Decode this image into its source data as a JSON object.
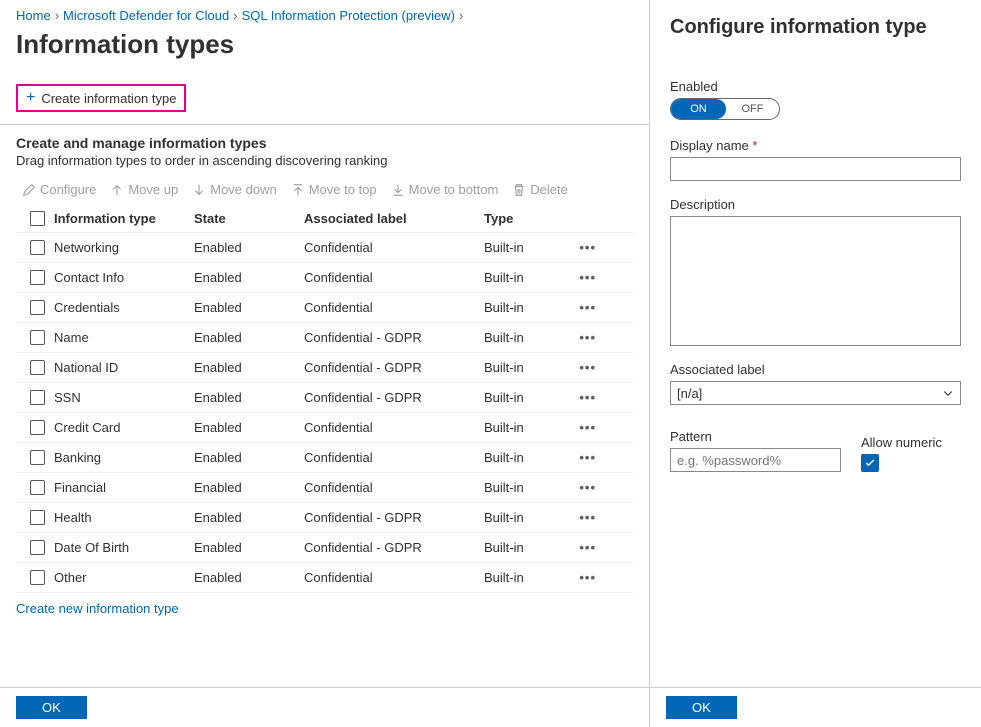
{
  "breadcrumb": {
    "items": [
      "Home",
      "Microsoft Defender for Cloud",
      "SQL Information Protection (preview)"
    ]
  },
  "title": "Information types",
  "create_button": "Create information type",
  "subheading": "Create and manage information types",
  "subtext": "Drag information types to order in ascending discovering ranking",
  "actions": {
    "configure": "Configure",
    "moveup": "Move up",
    "movedown": "Move down",
    "movetop": "Move to top",
    "movebottom": "Move to bottom",
    "delete": "Delete"
  },
  "columns": {
    "name": "Information type",
    "state": "State",
    "label": "Associated label",
    "type": "Type"
  },
  "rows": [
    {
      "name": "Networking",
      "state": "Enabled",
      "label": "Confidential",
      "type": "Built-in"
    },
    {
      "name": "Contact Info",
      "state": "Enabled",
      "label": "Confidential",
      "type": "Built-in"
    },
    {
      "name": "Credentials",
      "state": "Enabled",
      "label": "Confidential",
      "type": "Built-in"
    },
    {
      "name": "Name",
      "state": "Enabled",
      "label": "Confidential - GDPR",
      "type": "Built-in"
    },
    {
      "name": "National ID",
      "state": "Enabled",
      "label": "Confidential - GDPR",
      "type": "Built-in"
    },
    {
      "name": "SSN",
      "state": "Enabled",
      "label": "Confidential - GDPR",
      "type": "Built-in"
    },
    {
      "name": "Credit Card",
      "state": "Enabled",
      "label": "Confidential",
      "type": "Built-in"
    },
    {
      "name": "Banking",
      "state": "Enabled",
      "label": "Confidential",
      "type": "Built-in"
    },
    {
      "name": "Financial",
      "state": "Enabled",
      "label": "Confidential",
      "type": "Built-in"
    },
    {
      "name": "Health",
      "state": "Enabled",
      "label": "Confidential - GDPR",
      "type": "Built-in"
    },
    {
      "name": "Date Of Birth",
      "state": "Enabled",
      "label": "Confidential - GDPR",
      "type": "Built-in"
    },
    {
      "name": "Other",
      "state": "Enabled",
      "label": "Confidential",
      "type": "Built-in"
    }
  ],
  "create_link": "Create new information type",
  "ok_button": "OK",
  "panel": {
    "title": "Configure information type",
    "enabled_label": "Enabled",
    "on": "ON",
    "off": "OFF",
    "display_name_label": "Display name",
    "description_label": "Description",
    "associated_label_label": "Associated label",
    "associated_label_value": "[n/a]",
    "pattern_label": "Pattern",
    "pattern_placeholder": "e.g. %password%",
    "allow_numeric_label": "Allow numeric",
    "ok": "OK"
  }
}
